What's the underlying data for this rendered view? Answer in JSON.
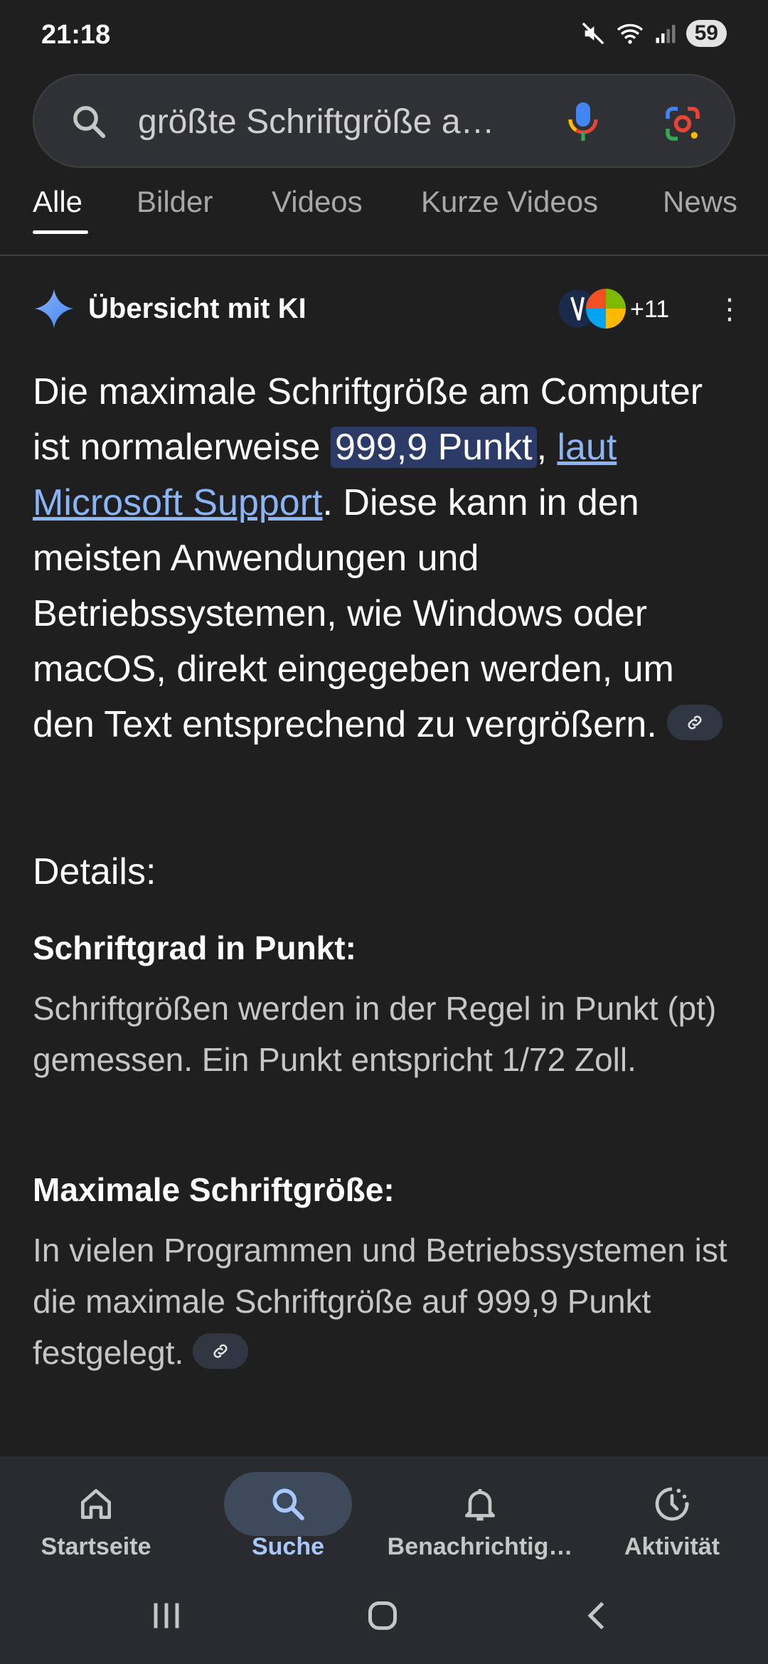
{
  "status_bar": {
    "time": "21:18",
    "battery": "59"
  },
  "search": {
    "query": "größte Schriftgröße a…"
  },
  "tabs": [
    {
      "label": "Alle",
      "active": true
    },
    {
      "label": "Bilder"
    },
    {
      "label": "Videos"
    },
    {
      "label": "Kurze Videos"
    },
    {
      "label": "News"
    }
  ],
  "ai_overview": {
    "title": "Übersicht mit KI",
    "sources_more": "+11",
    "answer": {
      "before": "Die maximale Schriftgröße am Computer ist normalerweise ",
      "highlight": "999,9 Punkt",
      "comma": ", ",
      "link": "laut Microsoft Support",
      "after": ". Diese kann in den meisten Anwendungen und Betriebssystemen, wie Windows oder macOS, direkt eingegeben werden, um den Text entsprechend zu vergrößern."
    },
    "details_heading": "Details:",
    "sections": [
      {
        "heading": "Schriftgrad in Punkt:",
        "text": "Schriftgrößen werden in der Regel in Punkt (pt) gemessen. Ein Punkt entspricht 1/72 Zoll."
      },
      {
        "heading": "Maximale Schriftgröße:",
        "text": "In vielen Programmen und Betriebssystemen ist die maximale Schriftgröße auf 999,9 Punkt festgelegt."
      }
    ]
  },
  "bottom_nav": [
    {
      "label": "Startseite",
      "icon": "home-icon"
    },
    {
      "label": "Suche",
      "icon": "search-icon",
      "active": true
    },
    {
      "label": "Benachrichtig…",
      "icon": "bell-icon"
    },
    {
      "label": "Aktivität",
      "icon": "activity-icon"
    }
  ],
  "colors": {
    "background": "#1f1f1f",
    "link": "#8ab4f8",
    "highlight": "#2b3a67",
    "active_nav": "#a8c7fa"
  }
}
